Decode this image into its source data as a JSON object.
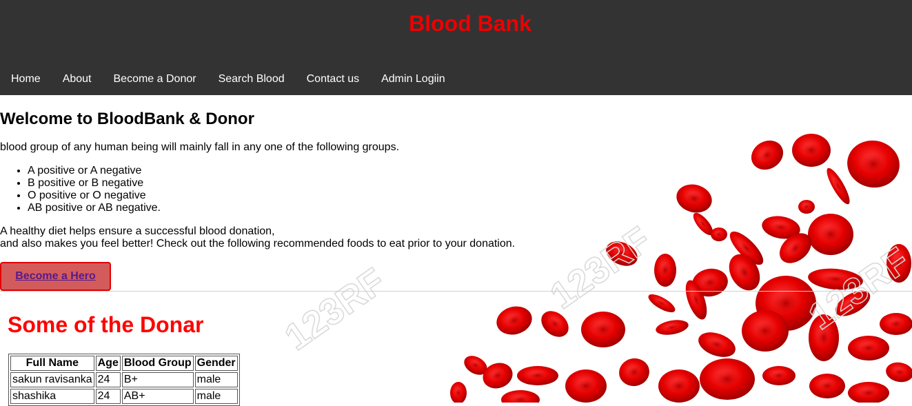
{
  "header": {
    "title": "Blood Bank",
    "nav": [
      "Home",
      "About",
      "Become a Donor",
      "Search Blood",
      "Contact us",
      "Admin Logiin"
    ]
  },
  "welcome": {
    "heading": "Welcome to BloodBank & Donor",
    "intro": "blood group of any human being will mainly fall in any one of the following groups.",
    "groups": [
      "A positive or A negative",
      "B positive or B negative",
      "O positive or O negative",
      "AB positive or AB negative."
    ],
    "diet_line1": "A healthy diet helps ensure a successful blood donation,",
    "diet_line2": "and also makes you feel better! Check out the following recommended foods to eat prior to your donation.",
    "hero_button": "Become a Hero"
  },
  "donors": {
    "heading": "Some of the Donar",
    "columns": [
      "Full Name",
      "Age",
      "Blood Group",
      "Gender"
    ],
    "rows": [
      [
        "sakun ravisanka",
        "24",
        "B+",
        "male"
      ],
      [
        "shashika",
        "24",
        "AB+",
        "male"
      ]
    ]
  },
  "background": {
    "watermark": "123RF",
    "cell_color": "#e00000"
  },
  "colors": {
    "header_bg": "#333333",
    "title": "#ee0000",
    "button_bg": "#d45b5b",
    "button_border": "#e20000"
  }
}
